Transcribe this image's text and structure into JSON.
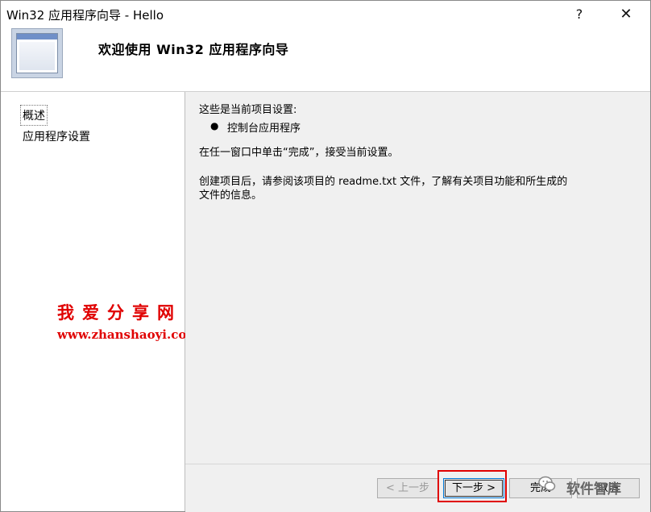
{
  "window": {
    "title": "Win32 应用程序向导 - Hello",
    "help_symbol": "?",
    "close_symbol": "✕"
  },
  "header": {
    "title": "欢迎使用 Win32 应用程序向导"
  },
  "sidebar": {
    "items": [
      {
        "label": "概述",
        "selected": true
      },
      {
        "label": "应用程序设置",
        "selected": false
      }
    ]
  },
  "watermark": {
    "text": "我爱分享网",
    "url": "www.zhanshaoyi.com",
    "wechat_text": "软件智库"
  },
  "main": {
    "intro": "这些是当前项目设置:",
    "bullets": [
      "控制台应用程序"
    ],
    "line2": "在任一窗口中单击“完成”，接受当前设置。",
    "line3a": "创建项目后，请参阅该项目的 readme.txt 文件，了解有关项目功能和所生成的",
    "line3b": "文件的信息。"
  },
  "footer": {
    "back_label": "< 上一步",
    "next_label": "下一步 >",
    "finish_label": "完成",
    "cancel_label": "取消"
  },
  "colors": {
    "watermark": "#e00000",
    "panel_bg": "#f0f0f0",
    "highlight": "#e00000"
  }
}
